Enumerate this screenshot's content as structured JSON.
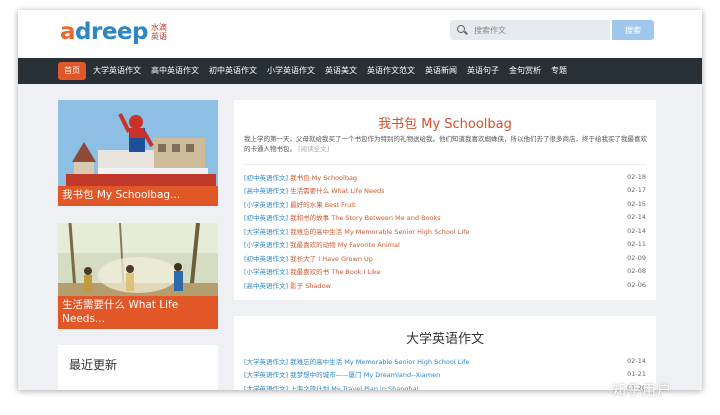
{
  "header": {
    "logo_main_a": "a",
    "logo_main_rest": "dreep",
    "logo_sub_1": "水滴",
    "logo_sub_2": "英语",
    "search_placeholder": "搜索作文",
    "search_button": "搜索"
  },
  "nav": {
    "items": [
      "首页",
      "大学英语作文",
      "高中英语作文",
      "初中英语作文",
      "小学英语作文",
      "英语美文",
      "英语作文范文",
      "英语新闻",
      "英语句子",
      "金句赏析",
      "专题"
    ],
    "active_index": 0
  },
  "sidebar": {
    "card1_caption": "我书包 My Schoolbag...",
    "card2_caption": "生活需要什么 What Life Needs...",
    "recent_title": "最近更新"
  },
  "panel1": {
    "title": "我书包 My Schoolbag",
    "intro": "我上学的第一天，父母就给我买了一个书包作为特别的礼物送给我。他们知道我喜欢蜘蛛侠，所以他们去了很多商店，终于给我买了我最喜欢的卡通人物书包。",
    "more": "[阅读全文]",
    "rows": [
      {
        "cat": "[初中英语作文]",
        "title": "我书包 My Schoolbag",
        "date": "02-18"
      },
      {
        "cat": "[高中英语作文]",
        "title": "生活需要什么 What Life Needs",
        "date": "02-17"
      },
      {
        "cat": "[小学英语作文]",
        "title": "最好的水果 Best Fruit",
        "date": "02-15"
      },
      {
        "cat": "[初中英语作文]",
        "title": "我和书的故事 The Story Between Me and Books",
        "date": "02-14"
      },
      {
        "cat": "[大学英语作文]",
        "title": "我难忘的高中生活 My Memorable Senior High School Life",
        "date": "02-14"
      },
      {
        "cat": "[小学英语作文]",
        "title": "我最喜欢的动物 My Favorite Animal",
        "date": "02-11"
      },
      {
        "cat": "[初中英语作文]",
        "title": "我长大了 I Have Grown Up",
        "date": "02-09"
      },
      {
        "cat": "[小学英语作文]",
        "title": "我最喜欢的书 The Book I Like",
        "date": "02-08"
      },
      {
        "cat": "[高中英语作文]",
        "title": "影子 Shadow",
        "date": "02-06"
      }
    ]
  },
  "panel2": {
    "title": "大学英语作文",
    "rows": [
      {
        "cat": "[大学英语作文]",
        "title": "我难忘的高中生活 My Memorable Senior High School Life",
        "date": "02-14"
      },
      {
        "cat": "[大学英语作文]",
        "title": "我梦想中的城市——厦门 My Dreamland--Xiamen",
        "date": "01-21"
      },
      {
        "cat": "[大学英语作文]",
        "title": "上海之旅计划 My Travel Plan in Shanghai",
        "date": "01-20"
      }
    ]
  },
  "watermark": "知乎用户",
  "colors": {
    "accent": "#e25727",
    "nav_bg": "#273036",
    "link_blue": "#2d86c6",
    "title_red": "#d2512b"
  }
}
